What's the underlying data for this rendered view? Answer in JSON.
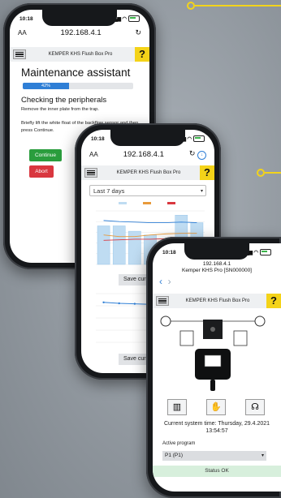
{
  "colors": {
    "accent": "#f4d319",
    "continue": "#2a9d3d",
    "abort": "#d9373f",
    "progress": "#2f7fd6",
    "status_ok_bg": "#d7efdc"
  },
  "phone1": {
    "time": "10:18",
    "aa": "AA",
    "url": "192.168.4.1",
    "app_title": "KEMPER KHS Flush Box Pro",
    "help": "?",
    "heading": "Maintenance assistant",
    "progress": {
      "label": "42%",
      "value": 42
    },
    "subheading": "Checking the peripherals",
    "text1": "Remove the inner plate from the trap.",
    "text2": "Briefly lift the white float of the backflow sensor and then press Continue.",
    "continue": "Continue",
    "abort": "Abort"
  },
  "phone2": {
    "time": "10:18",
    "aa": "AA",
    "url": "192.168.4.1",
    "app_title": "KEMPER KHS Flush Box Pro",
    "help": "?",
    "period": "Last 7 days",
    "save": "Save curr",
    "save2": "Save curr",
    "bars": [
      0.72,
      0.72,
      0.62,
      0.55,
      0.0,
      0.92,
      0.78
    ],
    "line1": [
      0.55,
      0.52,
      0.52,
      0.55,
      0.57,
      0.58,
      0.58
    ],
    "line2": [
      0.45,
      0.46,
      0.47,
      0.47,
      0.48,
      0.49,
      0.49
    ],
    "line3": [
      0.82,
      0.8,
      0.79,
      0.78,
      0.78,
      0.79,
      0.78
    ]
  },
  "phone3": {
    "time": "10:18",
    "url_line1": "192.168.4.1",
    "url_line2": "Kemper KHS Pro [SN000000]",
    "app_title": "KEMPER KHS Flush Box Pro",
    "help": "?",
    "system_time": "Current system time: Thursday, 29.4.2021 13:54:57",
    "program_label": "Active program",
    "program_value": "P1 (P1)",
    "status": "Status OK",
    "icons": [
      "chart-icon",
      "hand-icon",
      "headset-icon"
    ]
  }
}
